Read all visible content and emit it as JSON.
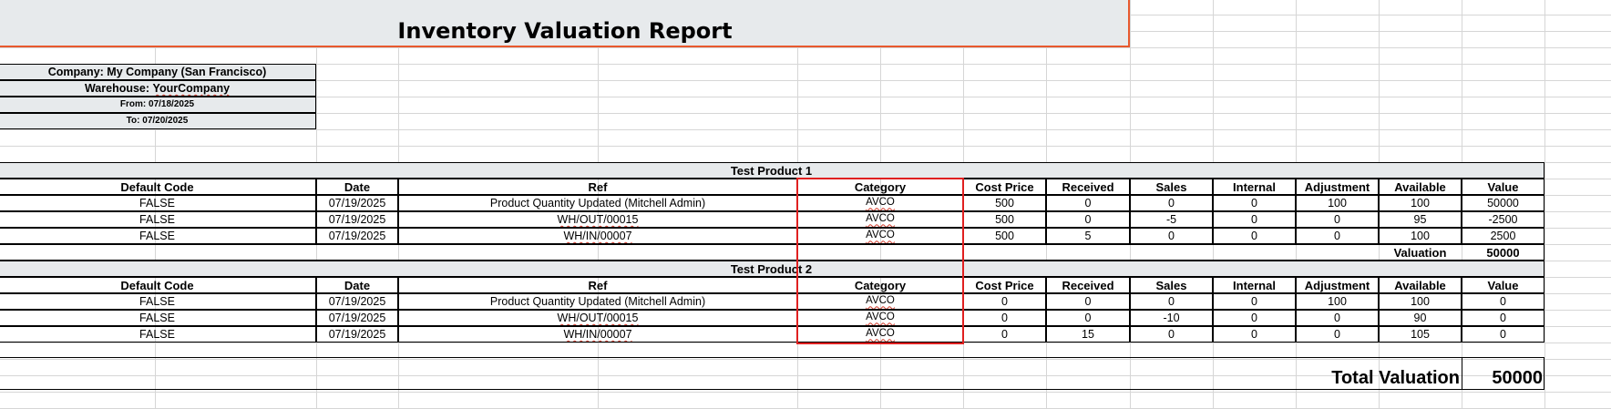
{
  "report": {
    "title": "Inventory Valuation Report"
  },
  "info": {
    "company": "Company: My Company (San Francisco)",
    "warehouse_prefix": "Warehouse: ",
    "warehouse_name": "YourCompany",
    "from": "From: 07/18/2025",
    "to": "To: 07/20/2025"
  },
  "columns": [
    "Default Code",
    "Date",
    "Ref",
    "Category",
    "Cost Price",
    "Received",
    "Sales",
    "Internal",
    "Adjustment",
    "Available",
    "Value"
  ],
  "products": [
    {
      "name": "Test Product 1",
      "rows": [
        [
          "FALSE",
          "07/19/2025",
          "Product Quantity Updated (Mitchell Admin)",
          "AVCO",
          "500",
          "0",
          "0",
          "0",
          "100",
          "100",
          "50000"
        ],
        [
          "FALSE",
          "07/19/2025",
          "WH/OUT/00015",
          "AVCO",
          "500",
          "0",
          "-5",
          "0",
          "0",
          "95",
          "-2500"
        ],
        [
          "FALSE",
          "07/19/2025",
          "WH/IN/00007",
          "AVCO",
          "500",
          "5",
          "0",
          "0",
          "0",
          "100",
          "2500"
        ]
      ],
      "valuation_label": "Valuation",
      "valuation_value": "50000"
    },
    {
      "name": "Test Product 2",
      "rows": [
        [
          "FALSE",
          "07/19/2025",
          "Product Quantity Updated (Mitchell Admin)",
          "AVCO",
          "0",
          "0",
          "0",
          "0",
          "100",
          "100",
          "0"
        ],
        [
          "FALSE",
          "07/19/2025",
          "WH/OUT/00015",
          "AVCO",
          "0",
          "0",
          "-10",
          "0",
          "0",
          "90",
          "0"
        ],
        [
          "FALSE",
          "07/19/2025",
          "WH/IN/00007",
          "AVCO",
          "0",
          "15",
          "0",
          "0",
          "0",
          "105",
          "0"
        ]
      ]
    }
  ],
  "total": {
    "label": "Total Valuation",
    "value": "50000"
  },
  "colors": {
    "highlight": "#e02020",
    "title_border": "#e8592e",
    "header_fill": "#e7eaec"
  }
}
